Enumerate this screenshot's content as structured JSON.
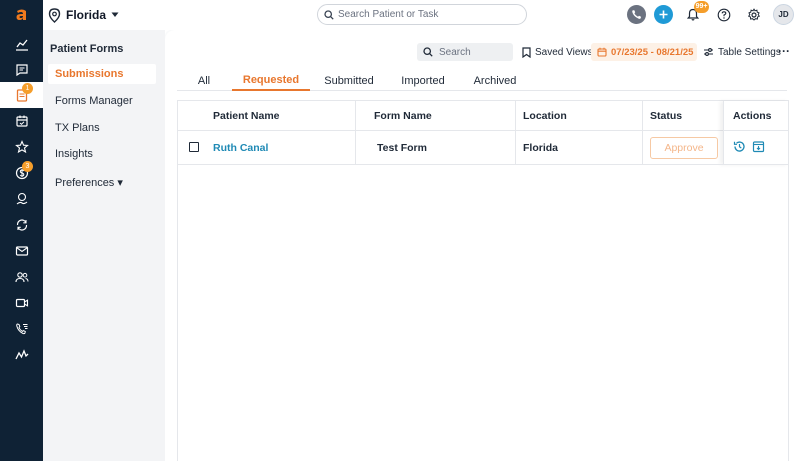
{
  "colors": {
    "accent": "#e8772e",
    "rail_bg": "#0f2235",
    "link": "#1f8ab5",
    "badge": "#f59e2b"
  },
  "topbar": {
    "location": "Florida",
    "search_placeholder": "Search Patient or Task",
    "notification_badge": "99+",
    "user_initials": "JD"
  },
  "rail": {
    "forms_badge": "1",
    "billing_badge": "3"
  },
  "subnav": {
    "title": "Patient Forms",
    "items": [
      {
        "label": "Submissions",
        "active": true
      },
      {
        "label": "Forms Manager"
      },
      {
        "label": "TX Plans"
      },
      {
        "label": "Insights"
      },
      {
        "label": "Preferences ▾"
      }
    ]
  },
  "toolbar": {
    "search_placeholder": "Search",
    "saved_views": "Saved Views",
    "date_range": "07/23/25 - 08/21/25",
    "table_settings": "Table Settings",
    "more": "···"
  },
  "tabs": [
    {
      "label": "All"
    },
    {
      "label": "Requested",
      "active": true
    },
    {
      "label": "Submitted"
    },
    {
      "label": "Imported"
    },
    {
      "label": "Archived"
    }
  ],
  "table": {
    "headers": [
      "Patient Name",
      "Form Name",
      "Location",
      "Status",
      "Actions"
    ],
    "rows": [
      {
        "patient": "Ruth Canal",
        "form": "Test Form",
        "location": "Florida",
        "status_button": "Approve"
      }
    ]
  }
}
